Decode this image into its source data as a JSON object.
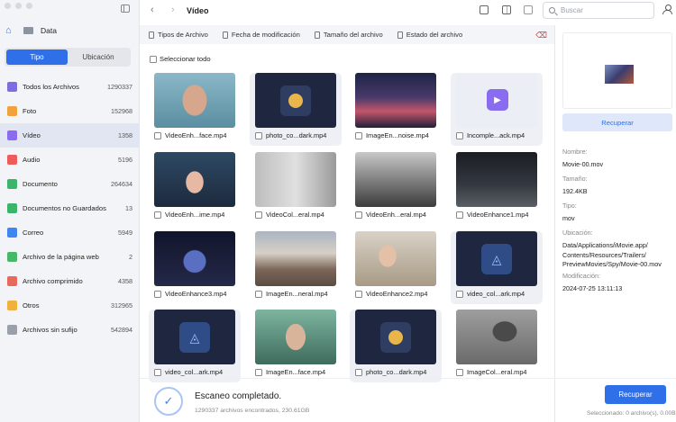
{
  "window": {
    "title": "Vídeo"
  },
  "sidebar": {
    "drive_label": "Data",
    "tabs": [
      {
        "label": "Tipo",
        "active": true
      },
      {
        "label": "Ubicación",
        "active": false
      }
    ],
    "categories": [
      {
        "label": "Todos los Archivos",
        "count": "1290337",
        "color": "#7a6ee0",
        "icon": "grid-icon"
      },
      {
        "label": "Foto",
        "count": "152968",
        "color": "#f2a23b",
        "icon": "photo-icon"
      },
      {
        "label": "Vídeo",
        "count": "1358",
        "color": "#8b6bf0",
        "icon": "video-icon",
        "selected": true
      },
      {
        "label": "Audio",
        "count": "5196",
        "color": "#ef5a5a",
        "icon": "audio-icon"
      },
      {
        "label": "Documento",
        "count": "264634",
        "color": "#3bb56b",
        "icon": "document-icon"
      },
      {
        "label": "Documentos no Guardados",
        "count": "13",
        "color": "#3bb56b",
        "icon": "unsaved-document-icon"
      },
      {
        "label": "Correo",
        "count": "5949",
        "color": "#3f86f0",
        "icon": "mail-icon"
      },
      {
        "label": "Archivo de la página web",
        "count": "2",
        "color": "#47b86a",
        "icon": "web-icon"
      },
      {
        "label": "Archivo comprimido",
        "count": "4358",
        "color": "#e86a5a",
        "icon": "archive-icon"
      },
      {
        "label": "Otros",
        "count": "312965",
        "color": "#f0b23b",
        "icon": "other-icon"
      },
      {
        "label": "Archivos sin sufijo",
        "count": "542894",
        "color": "#9aa0aa",
        "icon": "no-suffix-icon"
      }
    ]
  },
  "search": {
    "placeholder": "Buscar"
  },
  "filters": [
    "Tipos de Archivo",
    "Fecha de modificación",
    "Tamaño del archivo",
    "Estado del archivo"
  ],
  "select_all_label": "Seleccionar todo",
  "files": [
    {
      "name": "VideoEnh...face.mp4",
      "kind": "portrait-blue"
    },
    {
      "name": "photo_co...dark.mp4",
      "kind": "placeholder-photo"
    },
    {
      "name": "ImageEn...noise.mp4",
      "kind": "city-night"
    },
    {
      "name": "Incomple...ack.mp4",
      "kind": "placeholder-video"
    },
    {
      "name": "VideoEnh...ime.mp4",
      "kind": "anime-girl"
    },
    {
      "name": "VideoCol...eral.mp4",
      "kind": "bw-couple"
    },
    {
      "name": "VideoEnh...eral.mp4",
      "kind": "bw-coast"
    },
    {
      "name": "VideoEnhance1.mp4",
      "kind": "dark-stage"
    },
    {
      "name": "VideoEnhance3.mp4",
      "kind": "anime-boy"
    },
    {
      "name": "ImageEn...neral.mp4",
      "kind": "mountains"
    },
    {
      "name": "VideoEnhance2.mp4",
      "kind": "woman-phone"
    },
    {
      "name": "video_col...ark.mp4",
      "kind": "placeholder-edit"
    },
    {
      "name": "video_col...ark.mp4",
      "kind": "placeholder-edit-video"
    },
    {
      "name": "ImageEn...face.mp4",
      "kind": "woman-green"
    },
    {
      "name": "photo_co...dark.mp4",
      "kind": "placeholder-photo"
    },
    {
      "name": "ImageCol...eral.mp4",
      "kind": "butterfly"
    }
  ],
  "details": {
    "recover_label": "Recuperar",
    "name_label": "Nombre:",
    "name": "Movie-00.mov",
    "size_label": "Tamaño:",
    "size": "192.4KB",
    "type_label": "Tipo:",
    "type": "mov",
    "location_label": "Ubicación:",
    "location": "Data/Applications/iMovie.app/\nContents/Resources/Trailers/\nPreviewMovies/Spy/Movie-00.mov",
    "modified_label": "Modificación:",
    "modified": "2024-07-25 13:11:13"
  },
  "status": {
    "title": "Escaneo completado.",
    "subtitle": "1290337 archivos encontrados, 230.61GB",
    "recover_button": "Recuperar",
    "selected": "Seleccionado: 0 archivo(s), 0.00B"
  }
}
